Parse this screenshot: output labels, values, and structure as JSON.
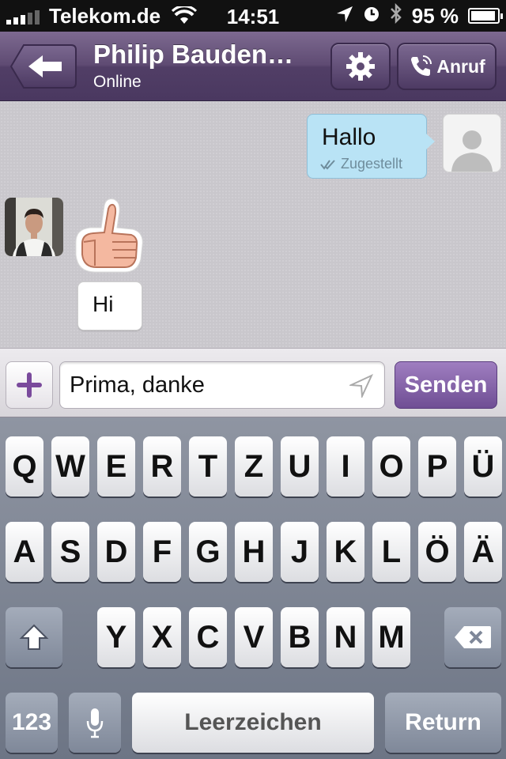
{
  "status_bar": {
    "carrier": "Telekom.de",
    "time": "14:51",
    "battery": "95 %",
    "battery_level": 0.95,
    "icons": [
      "signal-bars",
      "wifi-icon",
      "location-arrow-icon",
      "alarm-clock-icon",
      "bluetooth-icon",
      "battery-icon"
    ]
  },
  "header": {
    "contact_name": "Philip Bauden…",
    "contact_status": "Online",
    "call_label": "Anruf",
    "icons": [
      "back-arrow-icon",
      "gear-icon",
      "phone-icon"
    ]
  },
  "chat": {
    "outgoing": [
      {
        "text": "Hallo",
        "status": "Zugestellt"
      }
    ],
    "incoming": [
      {
        "sticker": "thumbs-up"
      },
      {
        "text": "Hi"
      }
    ]
  },
  "composer": {
    "input_value": "Prima, danke",
    "send_label": "Senden"
  },
  "keyboard": {
    "row1": [
      "Q",
      "W",
      "E",
      "R",
      "T",
      "Z",
      "U",
      "I",
      "O",
      "P",
      "Ü"
    ],
    "row2": [
      "A",
      "S",
      "D",
      "F",
      "G",
      "H",
      "J",
      "K",
      "L",
      "Ö",
      "Ä"
    ],
    "row3": [
      "Y",
      "X",
      "C",
      "V",
      "B",
      "N",
      "M"
    ],
    "numbers_label": "123",
    "space_label": "Leerzeichen",
    "return_label": "Return"
  },
  "colors": {
    "header": "#5f4b73",
    "send_button": "#7f5ea6",
    "outgoing_bubble": "#b9e3f5"
  }
}
